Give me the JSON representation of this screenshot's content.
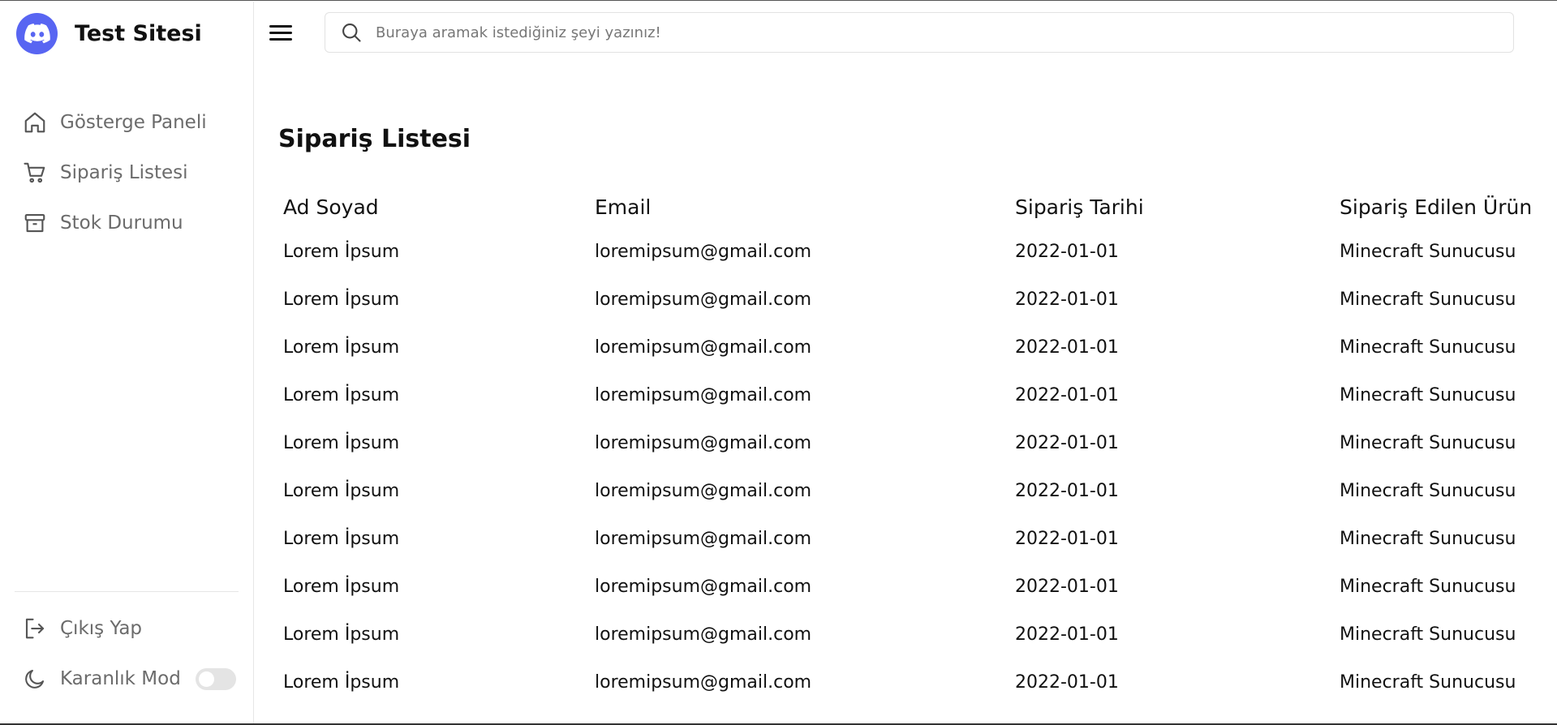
{
  "brand": {
    "name": "Test Sitesi",
    "logo_icon": "discord-logo-icon",
    "color": "#5865f2"
  },
  "sidebar": {
    "items": [
      {
        "label": "Gösterge Paneli",
        "icon": "home-icon"
      },
      {
        "label": "Sipariş Listesi",
        "icon": "cart-icon"
      },
      {
        "label": "Stok Durumu",
        "icon": "archive-icon"
      }
    ],
    "bottom": {
      "logout": {
        "label": "Çıkış Yap",
        "icon": "logout-icon"
      },
      "dark_mode": {
        "label": "Karanlık Mod",
        "icon": "moon-icon",
        "enabled": false
      }
    }
  },
  "header": {
    "menu_icon": "hamburger-icon",
    "search": {
      "placeholder": "Buraya aramak istediğiniz şeyi yazınız!",
      "value": "",
      "icon": "search-icon"
    }
  },
  "main": {
    "title": "Sipariş Listesi",
    "table": {
      "columns": [
        "Ad Soyad",
        "Email",
        "Sipariş Tarihi",
        "Sipariş Edilen Ürün"
      ],
      "rows": [
        [
          "Lorem İpsum",
          "loremipsum@gmail.com",
          "2022-01-01",
          "Minecraft Sunucusu"
        ],
        [
          "Lorem İpsum",
          "loremipsum@gmail.com",
          "2022-01-01",
          "Minecraft Sunucusu"
        ],
        [
          "Lorem İpsum",
          "loremipsum@gmail.com",
          "2022-01-01",
          "Minecraft Sunucusu"
        ],
        [
          "Lorem İpsum",
          "loremipsum@gmail.com",
          "2022-01-01",
          "Minecraft Sunucusu"
        ],
        [
          "Lorem İpsum",
          "loremipsum@gmail.com",
          "2022-01-01",
          "Minecraft Sunucusu"
        ],
        [
          "Lorem İpsum",
          "loremipsum@gmail.com",
          "2022-01-01",
          "Minecraft Sunucusu"
        ],
        [
          "Lorem İpsum",
          "loremipsum@gmail.com",
          "2022-01-01",
          "Minecraft Sunucusu"
        ],
        [
          "Lorem İpsum",
          "loremipsum@gmail.com",
          "2022-01-01",
          "Minecraft Sunucusu"
        ],
        [
          "Lorem İpsum",
          "loremipsum@gmail.com",
          "2022-01-01",
          "Minecraft Sunucusu"
        ],
        [
          "Lorem İpsum",
          "loremipsum@gmail.com",
          "2022-01-01",
          "Minecraft Sunucusu"
        ]
      ]
    }
  }
}
